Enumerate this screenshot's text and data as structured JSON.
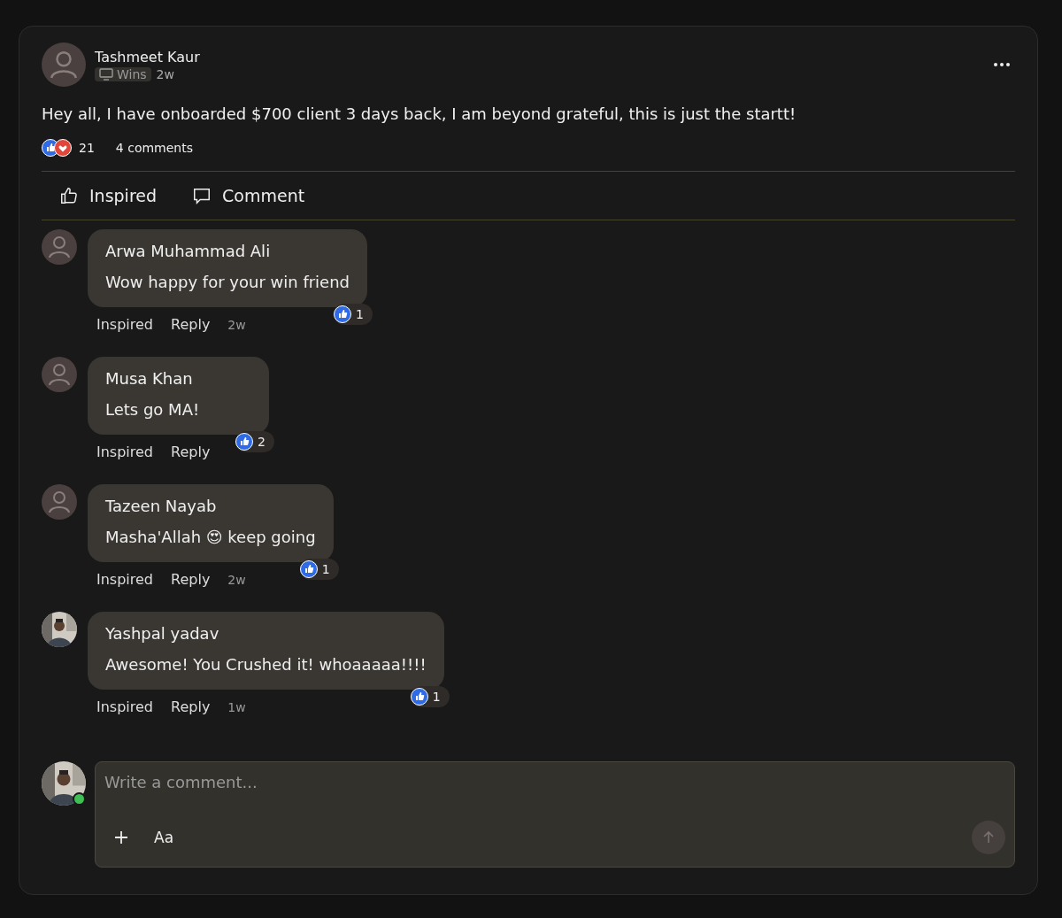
{
  "post": {
    "author": "Tashmeet Kaur",
    "space": "Wins",
    "time": "2w",
    "text": "Hey all, I have onboarded $700 client 3 days back, I am beyond grateful, this is just the startt!",
    "reaction_count": "21",
    "comment_count": "4 comments"
  },
  "actions": [
    {
      "kind": "like",
      "label": "Inspired"
    },
    {
      "kind": "comment",
      "label": "Comment"
    }
  ],
  "comments": [
    {
      "author": "Arwa Muhammad Ali",
      "text": "Wow happy for your win friend",
      "like": "Inspired",
      "reply": "Reply",
      "time": "2w",
      "reactions": "1",
      "kind": "plain"
    },
    {
      "author": "Musa Khan",
      "text": "Lets go MA!",
      "like": "Inspired",
      "reply": "Reply",
      "reactions": "2",
      "kind": "plain"
    },
    {
      "author": "Tazeen Nayab",
      "text": "Masha'Allah 😍 keep going",
      "like": "Inspired",
      "reply": "Reply",
      "time": "2w",
      "reactions": "1",
      "kind": "plain"
    },
    {
      "author": "Yashpal yadav",
      "text": "Awesome! You Crushed it! whoaaaaa!!!!",
      "like": "Inspired",
      "reply": "Reply",
      "time": "1w",
      "reactions": "1"
    }
  ],
  "composer": {
    "placeholder": "Write a comment...",
    "format": "Aa",
    "online": true
  }
}
